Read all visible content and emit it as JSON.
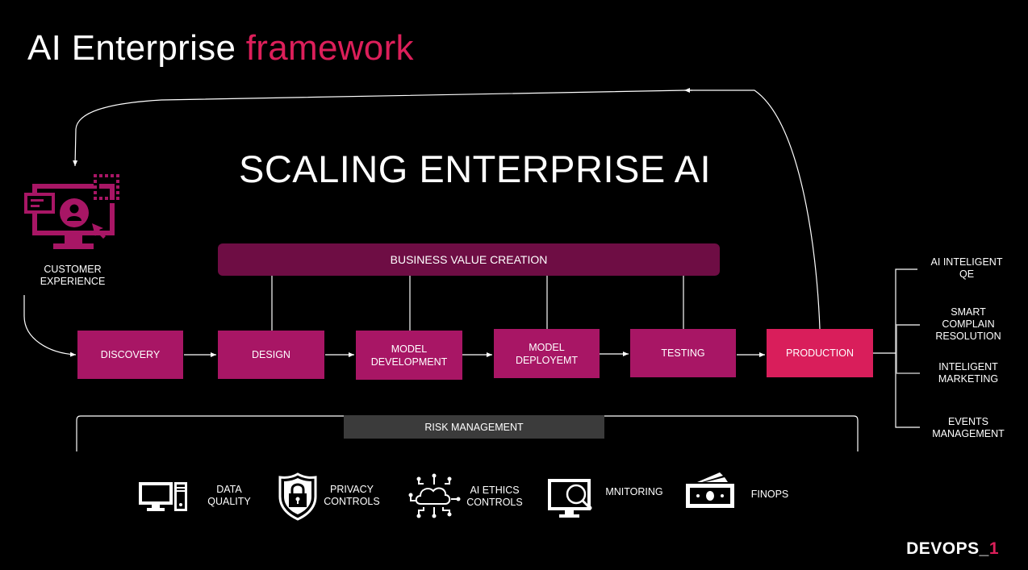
{
  "header": {
    "title_main": "AI Enterprise",
    "title_accent": "framework",
    "subtitle": "SCALING ENTERPRISE AI"
  },
  "colors": {
    "accent": "#dc1f5a",
    "step": "#a81665",
    "production": "#d91e5b",
    "business_value_bar": "#6e0d44",
    "risk_bar": "#3b3b3b",
    "background": "#000000"
  },
  "customer_experience": {
    "icon": "customer-experience-monitor-icon",
    "label_line1": "CUSTOMER",
    "label_line2": "EXPERIENCE"
  },
  "business_value": {
    "label": "BUSINESS VALUE CREATION"
  },
  "pipeline": {
    "steps": [
      {
        "line1": "DISCOVERY",
        "line2": ""
      },
      {
        "line1": "DESIGN",
        "line2": ""
      },
      {
        "line1": "MODEL",
        "line2": "DEVELOPMENT"
      },
      {
        "line1": "MODEL",
        "line2": "DEPLOYEMT"
      },
      {
        "line1": "TESTING",
        "line2": ""
      },
      {
        "line1": "PRODUCTION",
        "line2": ""
      }
    ]
  },
  "outcomes": [
    {
      "line1": "AI INTELIGENT",
      "line2": "QE",
      "line3": ""
    },
    {
      "line1": "SMART",
      "line2": "COMPLAIN",
      "line3": "RESOLUTION"
    },
    {
      "line1": "INTELIGENT",
      "line2": "MARKETING",
      "line3": ""
    },
    {
      "line1": "EVENTS",
      "line2": "MANAGEMENT",
      "line3": ""
    }
  ],
  "risk_management": {
    "label": "RISK MANAGEMENT"
  },
  "controls": [
    {
      "icon": "desktop-computer-icon",
      "line1": "DATA",
      "line2": "QUALITY"
    },
    {
      "icon": "shield-lock-icon",
      "line1": "PRIVACY",
      "line2": "CONTROLS"
    },
    {
      "icon": "cloud-network-icon",
      "line1": "AI ETHICS",
      "line2": "CONTROLS"
    },
    {
      "icon": "monitor-magnifier-icon",
      "line1": "MNITORING",
      "line2": ""
    },
    {
      "icon": "money-bills-icon",
      "line1": "FINOPS",
      "line2": ""
    }
  ],
  "brand": {
    "main": "DEVOPS_",
    "accent": "1"
  }
}
